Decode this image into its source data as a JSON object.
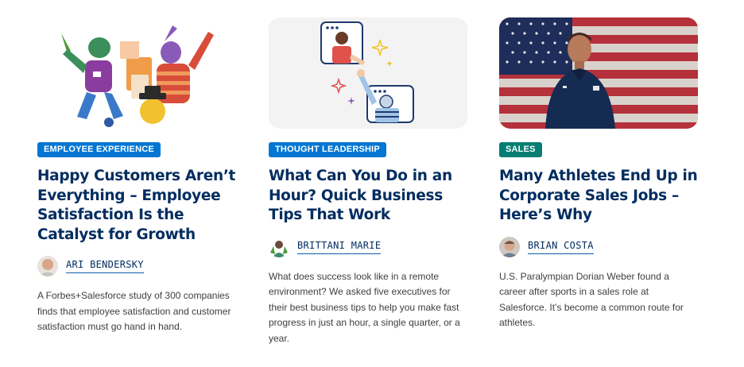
{
  "cards": [
    {
      "category": "EMPLOYEE EXPERIENCE",
      "category_color": "#0176d3",
      "title": "Happy Customers Aren’t Everything – Employee Satisfaction Is the Catalyst for Growth",
      "author": "ARI BENDERSKY",
      "summary": "A Forbes+Salesforce study of 300 companies finds that employee satisfaction and customer satisfaction must go hand in hand."
    },
    {
      "category": "THOUGHT LEADERSHIP",
      "category_color": "#0176d3",
      "title": "What Can You Do in an Hour? Quick Business Tips That Work",
      "author": "BRITTANI MARIE",
      "summary": "What does success look like in a remote environment? We asked five executives for their best business tips to help you make fast progress in just an hour, a single quarter, or a year."
    },
    {
      "category": "SALES",
      "category_color": "#047e73",
      "title": "Many Athletes End Up in Corporate Sales Jobs – Here’s Why",
      "author": "BRIAN COSTA",
      "summary": "U.S. Paralympian Dorian Weber found a career after sports in a sales role at Salesforce. It’s become a common route for athletes."
    }
  ],
  "colors": {
    "title": "#032d60",
    "author_underline": "#0b5cab"
  }
}
